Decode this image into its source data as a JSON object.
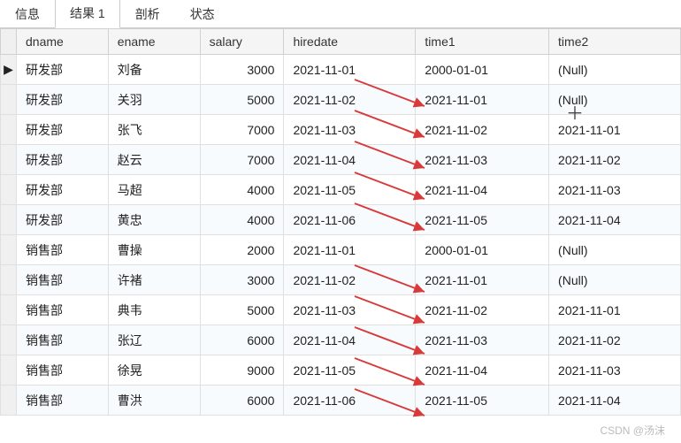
{
  "tabs": {
    "info": "信息",
    "result": "结果 1",
    "profile": "剖析",
    "status": "状态"
  },
  "columns": {
    "dname": "dname",
    "ename": "ename",
    "salary": "salary",
    "hiredate": "hiredate",
    "time1": "time1",
    "time2": "time2"
  },
  "null_text": "(Null)",
  "rows": [
    {
      "marker": "▶",
      "dname": "研发部",
      "ename": "刘备",
      "salary": "3000",
      "hiredate": "2021-11-01",
      "time1": "2000-01-01",
      "time2": null
    },
    {
      "marker": "",
      "dname": "研发部",
      "ename": "关羽",
      "salary": "5000",
      "hiredate": "2021-11-02",
      "time1": "2021-11-01",
      "time2": null
    },
    {
      "marker": "",
      "dname": "研发部",
      "ename": "张飞",
      "salary": "7000",
      "hiredate": "2021-11-03",
      "time1": "2021-11-02",
      "time2": "2021-11-01"
    },
    {
      "marker": "",
      "dname": "研发部",
      "ename": "赵云",
      "salary": "7000",
      "hiredate": "2021-11-04",
      "time1": "2021-11-03",
      "time2": "2021-11-02"
    },
    {
      "marker": "",
      "dname": "研发部",
      "ename": "马超",
      "salary": "4000",
      "hiredate": "2021-11-05",
      "time1": "2021-11-04",
      "time2": "2021-11-03"
    },
    {
      "marker": "",
      "dname": "研发部",
      "ename": "黄忠",
      "salary": "4000",
      "hiredate": "2021-11-06",
      "time1": "2021-11-05",
      "time2": "2021-11-04"
    },
    {
      "marker": "",
      "dname": "销售部",
      "ename": "曹操",
      "salary": "2000",
      "hiredate": "2021-11-01",
      "time1": "2000-01-01",
      "time2": null
    },
    {
      "marker": "",
      "dname": "销售部",
      "ename": "许褚",
      "salary": "3000",
      "hiredate": "2021-11-02",
      "time1": "2021-11-01",
      "time2": null
    },
    {
      "marker": "",
      "dname": "销售部",
      "ename": "典韦",
      "salary": "5000",
      "hiredate": "2021-11-03",
      "time1": "2021-11-02",
      "time2": "2021-11-01"
    },
    {
      "marker": "",
      "dname": "销售部",
      "ename": "张辽",
      "salary": "6000",
      "hiredate": "2021-11-04",
      "time1": "2021-11-03",
      "time2": "2021-11-02"
    },
    {
      "marker": "",
      "dname": "销售部",
      "ename": "徐晃",
      "salary": "9000",
      "hiredate": "2021-11-05",
      "time1": "2021-11-04",
      "time2": "2021-11-03"
    },
    {
      "marker": "",
      "dname": "销售部",
      "ename": "曹洪",
      "salary": "6000",
      "hiredate": "2021-11-06",
      "time1": "2021-11-05",
      "time2": "2021-11-04"
    }
  ],
  "watermark": "CSDN @汤沫"
}
